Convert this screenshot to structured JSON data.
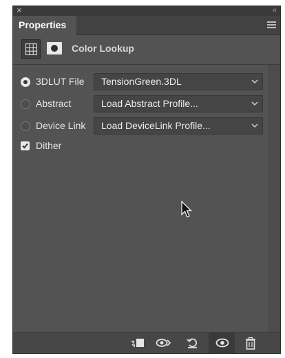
{
  "window": {
    "close_glyph": "×",
    "collapse_glyph": "‹‹"
  },
  "panel": {
    "tab_label": "Properties",
    "menu_icon": "panel-menu-icon"
  },
  "header": {
    "title": "Color Lookup",
    "adjustment_icon": "lookup-grid-icon",
    "mask_icon": "layer-mask-icon"
  },
  "lookup_rows": [
    {
      "label": "3DLUT File",
      "value": "TensionGreen.3DL",
      "selected": true
    },
    {
      "label": "Abstract",
      "value": "Load Abstract Profile...",
      "selected": false
    },
    {
      "label": "Device Link",
      "value": "Load DeviceLink Profile...",
      "selected": false
    }
  ],
  "dither": {
    "label": "Dither",
    "checked": true
  },
  "footer_buttons": [
    {
      "name": "clip-to-layer-icon"
    },
    {
      "name": "view-previous-state-icon"
    },
    {
      "name": "reset-adjustments-icon"
    },
    {
      "name": "toggle-visibility-icon",
      "active": true
    },
    {
      "name": "delete-layer-icon"
    }
  ],
  "colors": {
    "panel_bg": "#535353",
    "tabbar_bg": "#424242",
    "text": "#e6e6e6"
  }
}
